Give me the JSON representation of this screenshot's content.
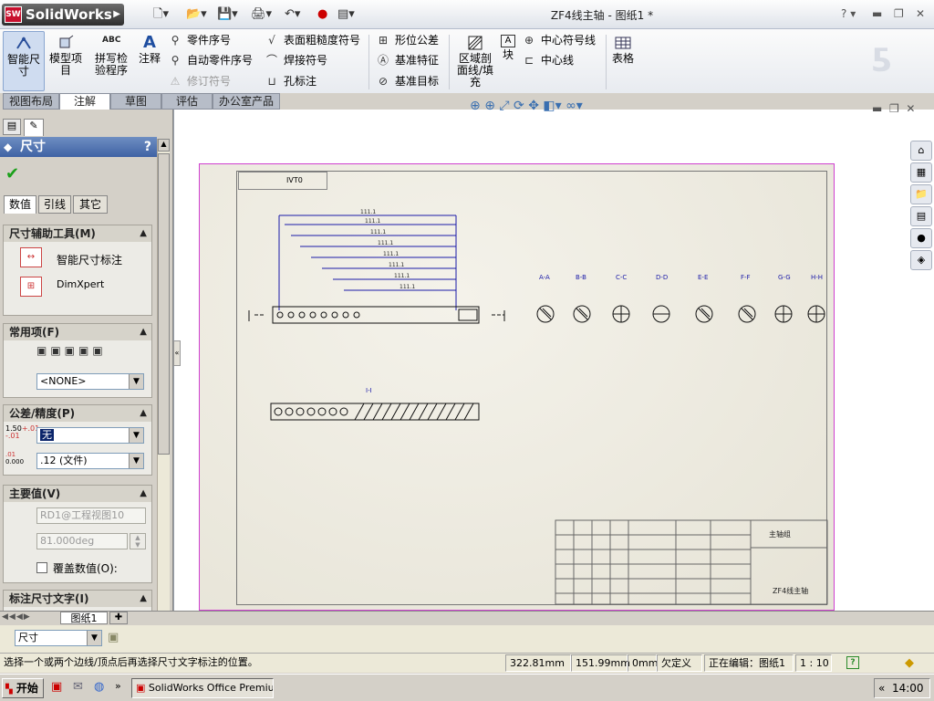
{
  "app": {
    "logo": "SolidWorks",
    "doc_title": "ZF4线主轴 - 图纸1 *",
    "help": "?"
  },
  "ribbon": {
    "smart_dim": "智能尺寸",
    "model_items": "模型项目",
    "spell": "拼写检验程序",
    "spell_abc": "ABC",
    "note": "注释",
    "balloon": "零件序号",
    "auto_balloon": "自动零件序号",
    "revision": "修订符号",
    "surface": "表面粗糙度符号",
    "weld": "焊接符号",
    "hole": "孔标注",
    "gtol": "形位公差",
    "datum_feature": "基准特征",
    "datum_target": "基准目标",
    "area_hatch": "区域剖面线/填充",
    "block": "块",
    "center_mark": "中心符号线",
    "centerline": "中心线",
    "table": "表格"
  },
  "tabs": [
    "视图布局",
    "注解",
    "草图",
    "评估",
    "办公室产品"
  ],
  "panel": {
    "title": "尺寸",
    "help": "?",
    "subtabs": [
      "数值",
      "引线",
      "其它"
    ],
    "assist_title": "尺寸辅助工具(M)",
    "assist_items": [
      "智能尺寸标注",
      "DimXpert"
    ],
    "common_title": "常用项(F)",
    "common_value": "<NONE>",
    "tol_title": "公差/精度(P)",
    "tol_type": "无",
    "tol_sample": "1.50",
    "tol_plus": "+.01",
    "tol_minus": "-.01",
    "prec_sample": "0.000",
    "prec_sup": ".01",
    "precision": ".12 (文件)",
    "primary_title": "主要值(V)",
    "primary_name": "RD1@工程视图10",
    "primary_value": "81.000deg",
    "override": "覆盖数值(O):",
    "dimtext_title": "标注尺寸文字(I)"
  },
  "drawing": {
    "top_label": "IVT0",
    "title_block": [
      "主轴组",
      "ZF4线主轴"
    ],
    "section_labels": [
      "A-A",
      "B-B",
      "C-C",
      "D-D",
      "E-E",
      "F-F",
      "G-G",
      "H-H"
    ],
    "detail_label": "I-I",
    "dim_labels": [
      "111.1",
      "111.1",
      "111.1",
      "111.1",
      "111.1",
      "111.1",
      "111.1",
      "111.1"
    ]
  },
  "sheet_tab": "图纸1",
  "bottom_select": "尺寸",
  "status": {
    "message": "选择一个或两个边线/顶点后再选择尺寸文字标注的位置。",
    "x": "322.81mm",
    "y": "151.99mm",
    "z": "0mm",
    "state": "欠定义",
    "editing": "正在编辑：图纸1",
    "scale": "1 : 10",
    "help": "?"
  },
  "taskbar": {
    "start": "开始",
    "task": "SolidWorks Office Premiu...",
    "time": "14:00",
    "more": "»",
    "tray_arrow": "«"
  }
}
